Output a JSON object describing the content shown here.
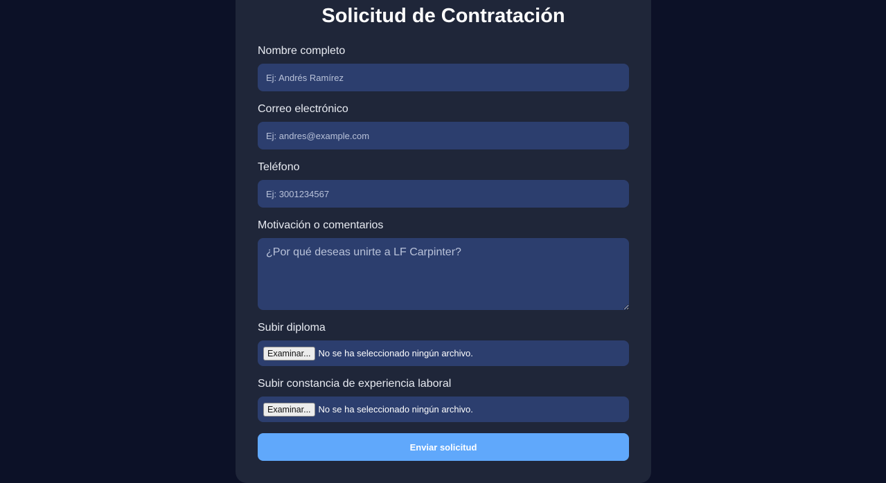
{
  "form": {
    "title": "Solicitud de Contratación",
    "name": {
      "label": "Nombre completo",
      "placeholder": "Ej: Andrés Ramírez",
      "value": ""
    },
    "email": {
      "label": "Correo electrónico",
      "placeholder": "Ej: andres@example.com",
      "value": ""
    },
    "phone": {
      "label": "Teléfono",
      "placeholder": "Ej: 3001234567",
      "value": ""
    },
    "motivation": {
      "label": "Motivación o comentarios",
      "placeholder": "¿Por qué deseas unirte a LF Carpinter?",
      "value": ""
    },
    "diploma": {
      "label": "Subir diploma",
      "button_label": "Examinar...",
      "status": "No se ha seleccionado ningún archivo."
    },
    "experience": {
      "label": "Subir constancia de experiencia laboral",
      "button_label": "Examinar...",
      "status": "No se ha seleccionado ningún archivo."
    },
    "submit_label": "Enviar solicitud"
  },
  "colors": {
    "page_background": "#0c1127",
    "card_background": "#1f2639",
    "field_background": "#2c3e6e",
    "accent": "#60a8fb"
  }
}
